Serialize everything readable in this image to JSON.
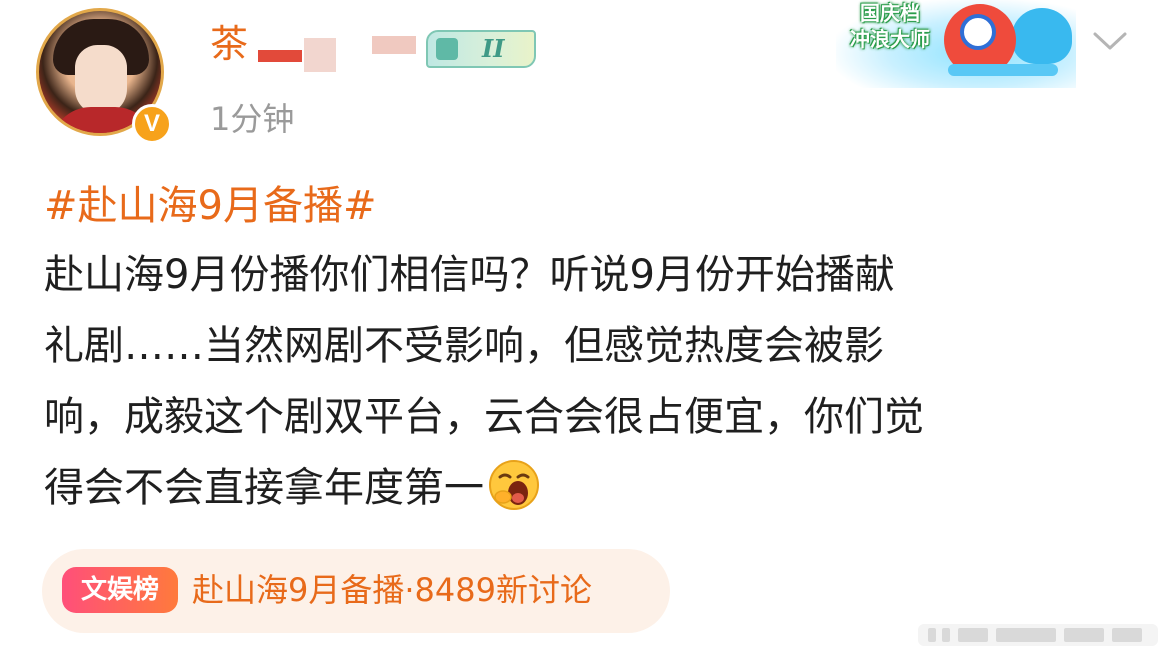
{
  "post": {
    "author": {
      "name_visible": "茶",
      "level_badge": "II",
      "verified_mark": "V"
    },
    "timestamp": "1分钟",
    "promo_badge": {
      "line1": "国庆档",
      "line2": "冲浪大师"
    },
    "hashtag": "#赴山海9月备播#",
    "body_lines": [
      "赴山海9月份播你们相信吗？听说9月份开始播献",
      "礼剧……当然网剧不受影响，但感觉热度会被影",
      "响，成毅这个剧双平台，云合会很占便宜，你们觉",
      "得会不会直接拿年度第一"
    ],
    "topic_card": {
      "chip_label": "文娱榜",
      "topic_name": "赴山海9月备播",
      "separator": "·",
      "count_text": "8489新讨论"
    }
  },
  "icons": {
    "more": "chevron-down-icon",
    "emoji": "yawning-face-emoji",
    "verified": "verified-badge-icon"
  },
  "colors": {
    "accent_orange": "#e86a1a",
    "topic_bg": "#fdf1e8",
    "chip_gradient_start": "#ff4f7a",
    "chip_gradient_end": "#ff7a3c",
    "timestamp_gray": "#9a9a9a",
    "verified_yellow": "#f7a21b"
  }
}
